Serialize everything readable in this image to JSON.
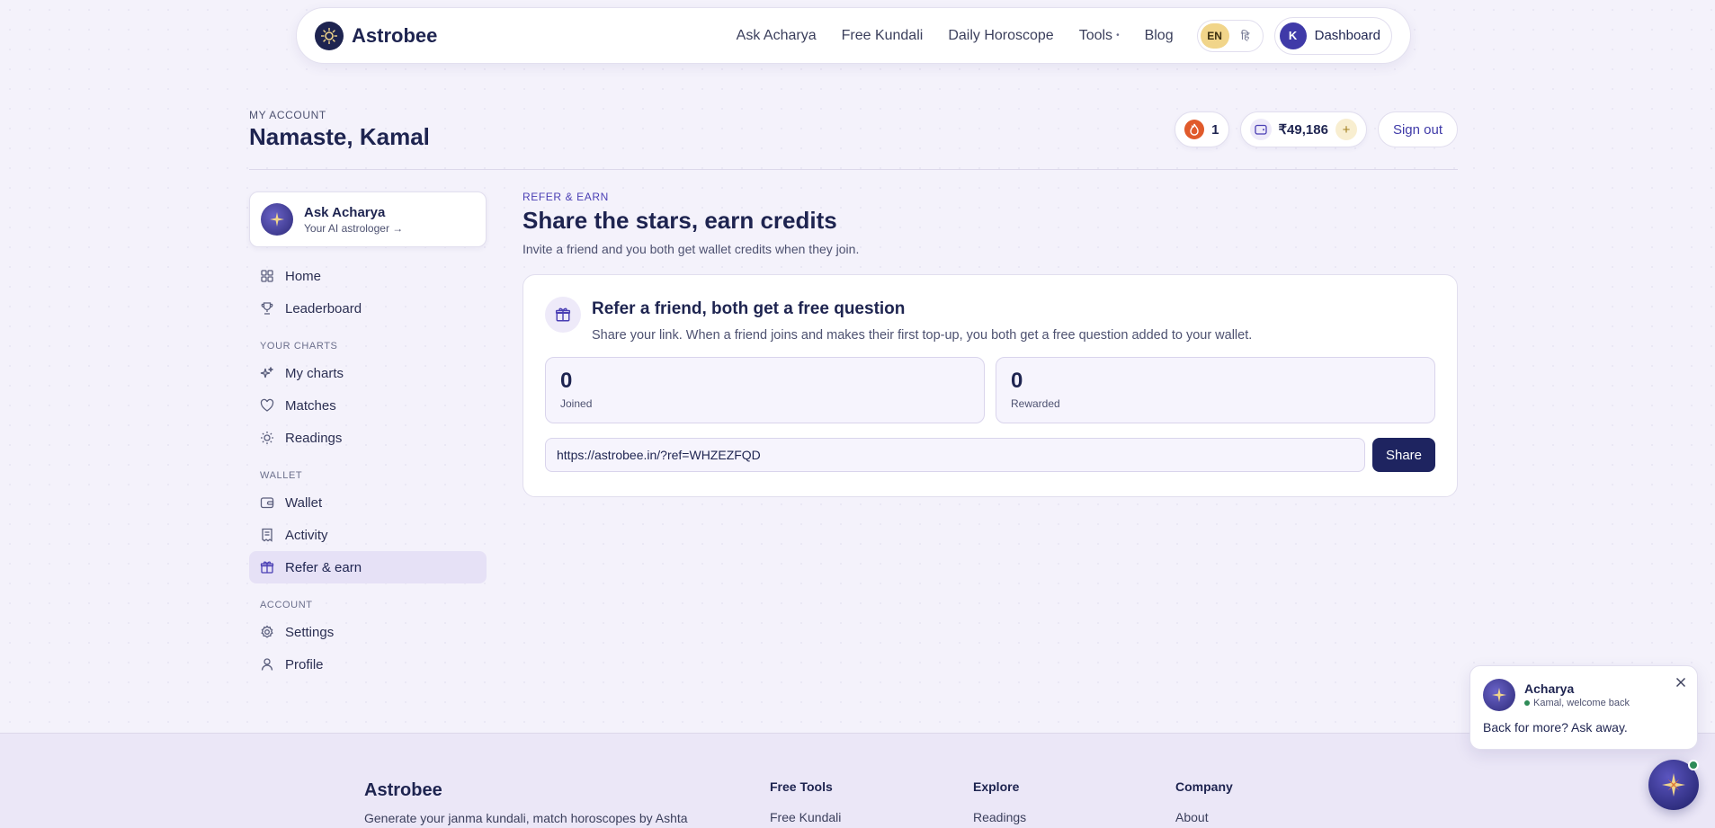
{
  "brand": {
    "name": "Astrobee"
  },
  "nav": {
    "links": [
      "Ask Acharya",
      "Free Kundali",
      "Daily Horoscope",
      "Tools",
      "Blog"
    ],
    "lang": {
      "en": "EN",
      "hi": "हि",
      "active": "EN"
    },
    "dashboard": {
      "avatar_letter": "K",
      "label": "Dashboard"
    }
  },
  "header": {
    "eyebrow": "MY ACCOUNT",
    "greeting": "Namaste, Kamal",
    "streak_count": "1",
    "wallet_amount": "₹49,186",
    "add_symbol": "+",
    "signout": "Sign out"
  },
  "sidebar": {
    "ask_card": {
      "title": "Ask Acharya",
      "subtitle": "Your AI astrologer →"
    },
    "items": [
      {
        "label": "Home",
        "icon": "grid-icon"
      },
      {
        "label": "Leaderboard",
        "icon": "trophy-icon"
      },
      {
        "section": "YOUR CHARTS"
      },
      {
        "label": "My charts",
        "icon": "sparkles-icon"
      },
      {
        "label": "Matches",
        "icon": "heart-icon"
      },
      {
        "label": "Readings",
        "icon": "sun-icon"
      },
      {
        "section": "WALLET"
      },
      {
        "label": "Wallet",
        "icon": "wallet-icon"
      },
      {
        "label": "Activity",
        "icon": "receipt-icon"
      },
      {
        "label": "Refer & earn",
        "icon": "gift-icon",
        "active": true
      },
      {
        "section": "ACCOUNT"
      },
      {
        "label": "Settings",
        "icon": "gear-icon"
      },
      {
        "label": "Profile",
        "icon": "user-icon"
      }
    ]
  },
  "main": {
    "eyebrow": "REFER & EARN",
    "title": "Share the stars, earn credits",
    "subtitle": "Invite a friend and you both get wallet credits when they join.",
    "card": {
      "title": "Refer a friend, both get a free question",
      "description": "Share your link. When a friend joins and makes their first top-up, you both get a free question added to your wallet.",
      "stats": [
        {
          "value": "0",
          "label": "Joined"
        },
        {
          "value": "0",
          "label": "Rewarded"
        }
      ],
      "link_value": "https://astrobee.in/?ref=WHZEZFQD",
      "share_label": "Share"
    }
  },
  "footer": {
    "brand": "Astrobee",
    "blurb": "Generate your janma kundali, match horoscopes by Ashta",
    "columns": [
      {
        "heading": "Free Tools",
        "first_link": "Free Kundali"
      },
      {
        "heading": "Explore",
        "first_link": "Readings"
      },
      {
        "heading": "Company",
        "first_link": "About"
      }
    ]
  },
  "chat": {
    "name": "Acharya",
    "status": "Kamal, welcome back",
    "message": "Back for more? Ask away."
  },
  "colors": {
    "navy": "#1e2450",
    "accent_purple": "#4a3fb4",
    "active_bg": "#e6e1f6",
    "gold": "#f1d58a",
    "streak_orange": "#e05a2b",
    "online_green": "#2e8b57"
  }
}
